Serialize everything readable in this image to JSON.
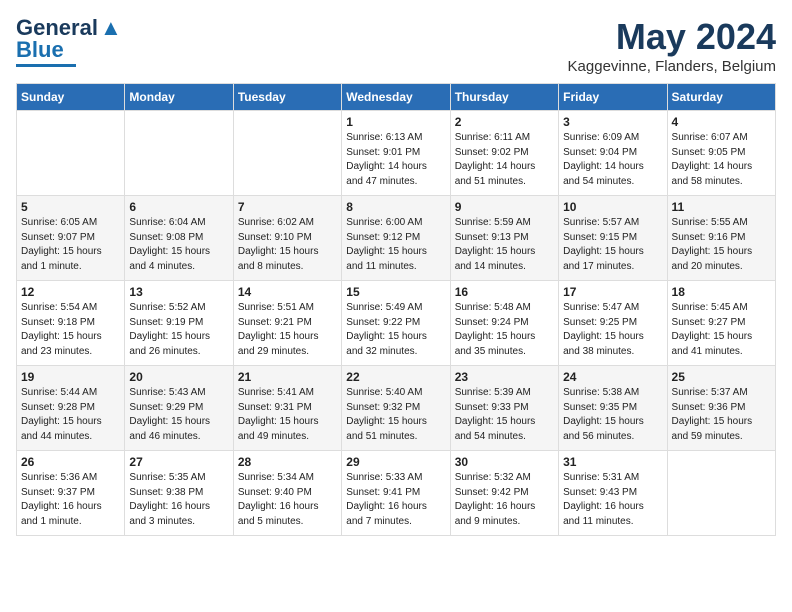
{
  "logo": {
    "line1": "General",
    "line2": "Blue"
  },
  "header": {
    "month_year": "May 2024",
    "location": "Kaggevinne, Flanders, Belgium"
  },
  "days_of_week": [
    "Sunday",
    "Monday",
    "Tuesday",
    "Wednesday",
    "Thursday",
    "Friday",
    "Saturday"
  ],
  "weeks": [
    [
      {
        "day": "",
        "info": ""
      },
      {
        "day": "",
        "info": ""
      },
      {
        "day": "",
        "info": ""
      },
      {
        "day": "1",
        "info": "Sunrise: 6:13 AM\nSunset: 9:01 PM\nDaylight: 14 hours\nand 47 minutes."
      },
      {
        "day": "2",
        "info": "Sunrise: 6:11 AM\nSunset: 9:02 PM\nDaylight: 14 hours\nand 51 minutes."
      },
      {
        "day": "3",
        "info": "Sunrise: 6:09 AM\nSunset: 9:04 PM\nDaylight: 14 hours\nand 54 minutes."
      },
      {
        "day": "4",
        "info": "Sunrise: 6:07 AM\nSunset: 9:05 PM\nDaylight: 14 hours\nand 58 minutes."
      }
    ],
    [
      {
        "day": "5",
        "info": "Sunrise: 6:05 AM\nSunset: 9:07 PM\nDaylight: 15 hours\nand 1 minute."
      },
      {
        "day": "6",
        "info": "Sunrise: 6:04 AM\nSunset: 9:08 PM\nDaylight: 15 hours\nand 4 minutes."
      },
      {
        "day": "7",
        "info": "Sunrise: 6:02 AM\nSunset: 9:10 PM\nDaylight: 15 hours\nand 8 minutes."
      },
      {
        "day": "8",
        "info": "Sunrise: 6:00 AM\nSunset: 9:12 PM\nDaylight: 15 hours\nand 11 minutes."
      },
      {
        "day": "9",
        "info": "Sunrise: 5:59 AM\nSunset: 9:13 PM\nDaylight: 15 hours\nand 14 minutes."
      },
      {
        "day": "10",
        "info": "Sunrise: 5:57 AM\nSunset: 9:15 PM\nDaylight: 15 hours\nand 17 minutes."
      },
      {
        "day": "11",
        "info": "Sunrise: 5:55 AM\nSunset: 9:16 PM\nDaylight: 15 hours\nand 20 minutes."
      }
    ],
    [
      {
        "day": "12",
        "info": "Sunrise: 5:54 AM\nSunset: 9:18 PM\nDaylight: 15 hours\nand 23 minutes."
      },
      {
        "day": "13",
        "info": "Sunrise: 5:52 AM\nSunset: 9:19 PM\nDaylight: 15 hours\nand 26 minutes."
      },
      {
        "day": "14",
        "info": "Sunrise: 5:51 AM\nSunset: 9:21 PM\nDaylight: 15 hours\nand 29 minutes."
      },
      {
        "day": "15",
        "info": "Sunrise: 5:49 AM\nSunset: 9:22 PM\nDaylight: 15 hours\nand 32 minutes."
      },
      {
        "day": "16",
        "info": "Sunrise: 5:48 AM\nSunset: 9:24 PM\nDaylight: 15 hours\nand 35 minutes."
      },
      {
        "day": "17",
        "info": "Sunrise: 5:47 AM\nSunset: 9:25 PM\nDaylight: 15 hours\nand 38 minutes."
      },
      {
        "day": "18",
        "info": "Sunrise: 5:45 AM\nSunset: 9:27 PM\nDaylight: 15 hours\nand 41 minutes."
      }
    ],
    [
      {
        "day": "19",
        "info": "Sunrise: 5:44 AM\nSunset: 9:28 PM\nDaylight: 15 hours\nand 44 minutes."
      },
      {
        "day": "20",
        "info": "Sunrise: 5:43 AM\nSunset: 9:29 PM\nDaylight: 15 hours\nand 46 minutes."
      },
      {
        "day": "21",
        "info": "Sunrise: 5:41 AM\nSunset: 9:31 PM\nDaylight: 15 hours\nand 49 minutes."
      },
      {
        "day": "22",
        "info": "Sunrise: 5:40 AM\nSunset: 9:32 PM\nDaylight: 15 hours\nand 51 minutes."
      },
      {
        "day": "23",
        "info": "Sunrise: 5:39 AM\nSunset: 9:33 PM\nDaylight: 15 hours\nand 54 minutes."
      },
      {
        "day": "24",
        "info": "Sunrise: 5:38 AM\nSunset: 9:35 PM\nDaylight: 15 hours\nand 56 minutes."
      },
      {
        "day": "25",
        "info": "Sunrise: 5:37 AM\nSunset: 9:36 PM\nDaylight: 15 hours\nand 59 minutes."
      }
    ],
    [
      {
        "day": "26",
        "info": "Sunrise: 5:36 AM\nSunset: 9:37 PM\nDaylight: 16 hours\nand 1 minute."
      },
      {
        "day": "27",
        "info": "Sunrise: 5:35 AM\nSunset: 9:38 PM\nDaylight: 16 hours\nand 3 minutes."
      },
      {
        "day": "28",
        "info": "Sunrise: 5:34 AM\nSunset: 9:40 PM\nDaylight: 16 hours\nand 5 minutes."
      },
      {
        "day": "29",
        "info": "Sunrise: 5:33 AM\nSunset: 9:41 PM\nDaylight: 16 hours\nand 7 minutes."
      },
      {
        "day": "30",
        "info": "Sunrise: 5:32 AM\nSunset: 9:42 PM\nDaylight: 16 hours\nand 9 minutes."
      },
      {
        "day": "31",
        "info": "Sunrise: 5:31 AM\nSunset: 9:43 PM\nDaylight: 16 hours\nand 11 minutes."
      },
      {
        "day": "",
        "info": ""
      }
    ]
  ]
}
